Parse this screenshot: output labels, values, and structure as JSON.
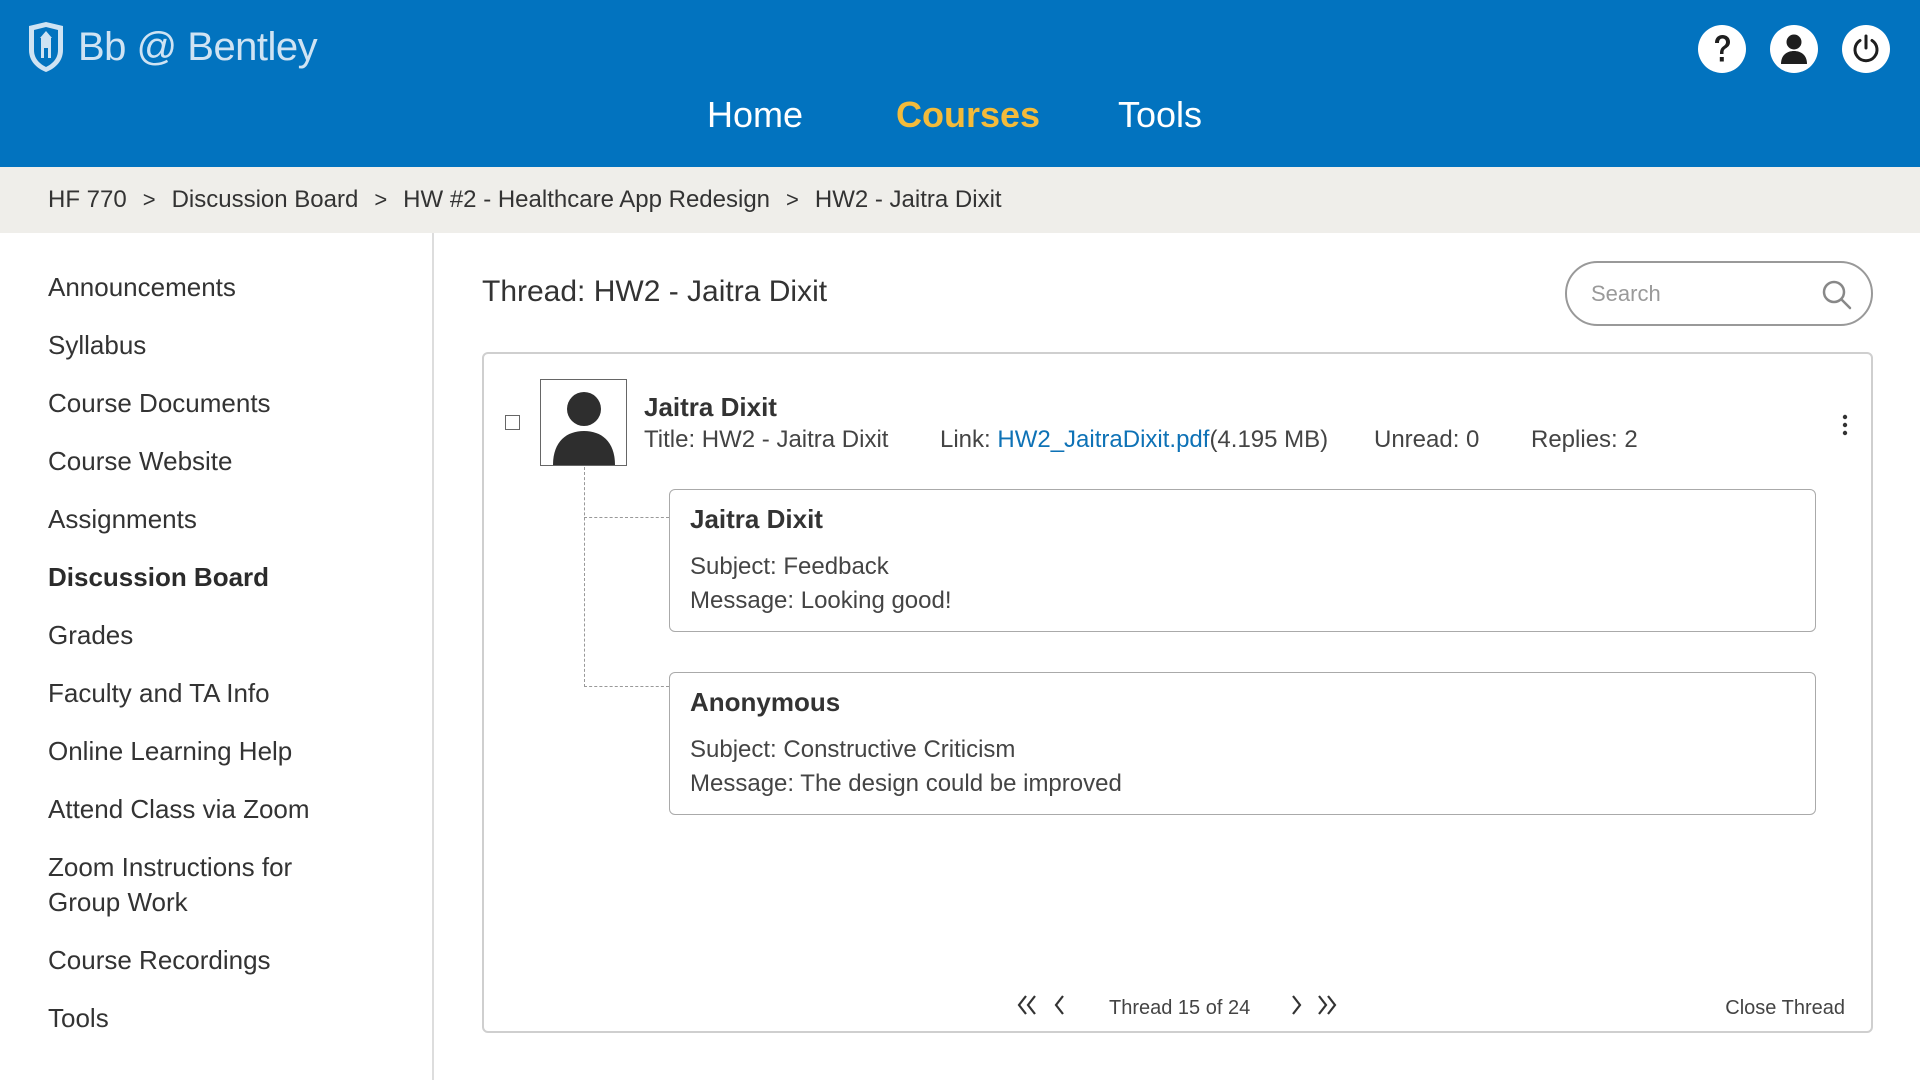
{
  "app": {
    "logo_text": "Bb @ Bentley",
    "icons": [
      "help-icon",
      "user-icon",
      "power-icon"
    ]
  },
  "nav": {
    "items": [
      {
        "label": "Home",
        "active": false
      },
      {
        "label": "Courses",
        "active": true
      },
      {
        "label": "Tools",
        "active": false
      }
    ]
  },
  "breadcrumb": {
    "items": [
      "HF 770",
      "Discussion Board",
      "HW #2 - Healthcare App Redesign",
      "HW2 - Jaitra Dixit"
    ],
    "separator": ">"
  },
  "sidebar": {
    "items": [
      {
        "label": "Announcements"
      },
      {
        "label": "Syllabus"
      },
      {
        "label": "Course Documents"
      },
      {
        "label": "Course Website"
      },
      {
        "label": "Assignments"
      },
      {
        "label": "Discussion Board",
        "active": true
      },
      {
        "label": "Grades"
      },
      {
        "label": "Faculty and TA Info"
      },
      {
        "label": "Online Learning Help"
      },
      {
        "label": "Attend Class via Zoom"
      },
      {
        "label": "Zoom Instructions for Group Work"
      },
      {
        "label": "Course Recordings"
      },
      {
        "label": "Tools"
      }
    ]
  },
  "main": {
    "thread_title": "Thread: HW2 - Jaitra Dixit",
    "search_placeholder": "Search",
    "post": {
      "author": "Jaitra Dixit",
      "title": "Title: HW2 - Jaitra Dixit",
      "link_label": "Link:",
      "link_file": "HW2_JaitraDixit.pdf",
      "link_size": "(4.195 MB)",
      "unread": "Unread: 0",
      "replies": "Replies: 2"
    },
    "replies": [
      {
        "author": "Jaitra Dixit",
        "subject": "Subject: Feedback",
        "message": "Message: Looking good!"
      },
      {
        "author": "Anonymous",
        "subject": "Subject: Constructive Criticism",
        "message": "Message: The design could be improved"
      }
    ],
    "pager": {
      "text": "Thread 15 of 24",
      "close_label": "Close Thread"
    }
  },
  "colors": {
    "header_bg": "#0273bf",
    "nav_active": "#f3bb3b",
    "breadcrumb_bg": "#efeeea",
    "link": "#0e72b6"
  }
}
